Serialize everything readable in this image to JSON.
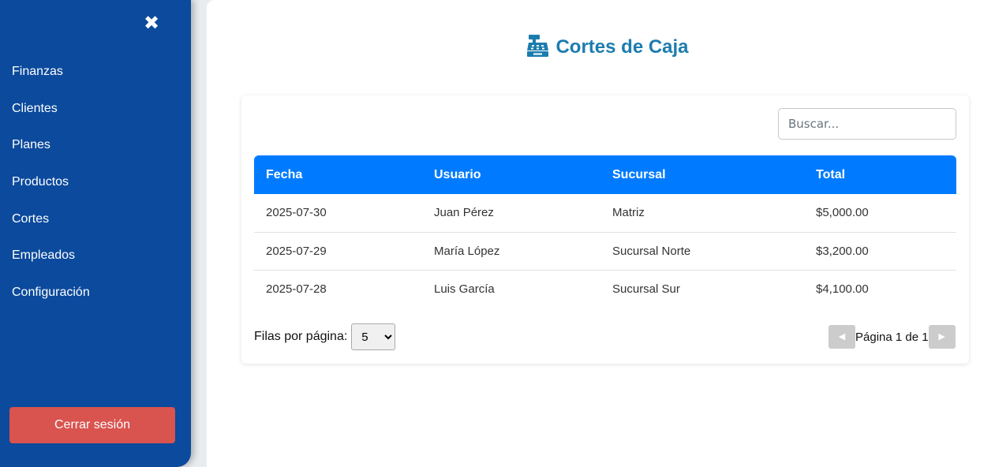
{
  "sidebar": {
    "close_icon": "✖",
    "items": [
      {
        "label": "Finanzas"
      },
      {
        "label": "Clientes"
      },
      {
        "label": "Planes"
      },
      {
        "label": "Productos"
      },
      {
        "label": "Cortes"
      },
      {
        "label": "Empleados"
      },
      {
        "label": "Configuración"
      }
    ],
    "logout_label": "Cerrar sesión"
  },
  "page": {
    "title": "Cortes de Caja",
    "title_icon": "cash-register-icon"
  },
  "search": {
    "placeholder": "Buscar..."
  },
  "table": {
    "headers": [
      "Fecha",
      "Usuario",
      "Sucursal",
      "Total"
    ],
    "rows": [
      [
        "2025-07-30",
        "Juan Pérez",
        "Matriz",
        "$5,000.00"
      ],
      [
        "2025-07-29",
        "María López",
        "Sucursal Norte",
        "$3,200.00"
      ],
      [
        "2025-07-28",
        "Luis García",
        "Sucursal Sur",
        "$4,100.00"
      ]
    ]
  },
  "pagination": {
    "rows_label": "Filas por página:",
    "rows_value": "5",
    "page_text": "Página 1 de 1",
    "prev_icon": "◀",
    "next_icon": "▶"
  },
  "colors": {
    "sidebar": "#0b4a9c",
    "title": "#1c7cae",
    "table_header": "#007bff",
    "logout": "#d9534f"
  }
}
